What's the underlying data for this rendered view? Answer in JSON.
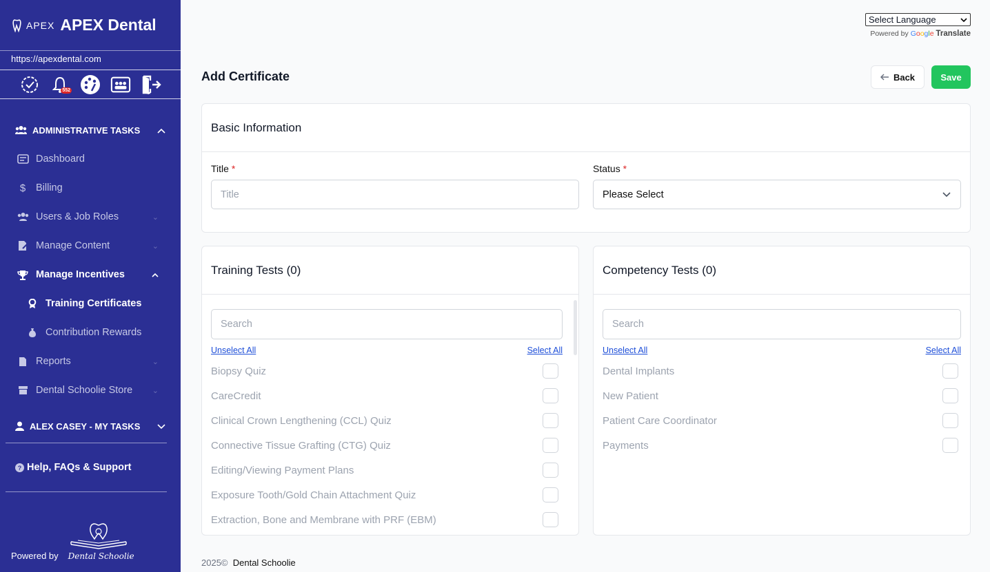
{
  "sidebar": {
    "brand_logo": "APEX",
    "brand_name": "APEX Dental",
    "site_url": "https://apexdental.com",
    "notification_count": "552",
    "admin_section": "ADMINISTRATIVE TASKS",
    "items": [
      {
        "label": "Dashboard"
      },
      {
        "label": "Billing"
      },
      {
        "label": "Users & Job Roles"
      },
      {
        "label": "Manage Content"
      },
      {
        "label": "Manage Incentives"
      },
      {
        "label": "Training Certificates"
      },
      {
        "label": "Contribution Rewards"
      },
      {
        "label": "Reports"
      },
      {
        "label": "Dental Schoolie Store"
      }
    ],
    "my_tasks_section": "ALEX CASEY - MY TASKS",
    "help": "Help, FAQs & Support",
    "powered_by": "Powered by",
    "powered_logo_text": "Dental Schoolie"
  },
  "translate": {
    "select_label": "Select Language",
    "powered_by": "Powered by",
    "translate_word": "Translate"
  },
  "page": {
    "title": "Add Certificate",
    "back": "Back",
    "save": "Save"
  },
  "basic": {
    "heading": "Basic Information",
    "title_label": "Title",
    "title_placeholder": "Title",
    "status_label": "Status",
    "status_value": "Please Select",
    "required_mark": "*"
  },
  "training": {
    "heading": "Training Tests (0)",
    "search_placeholder": "Search",
    "unselect_all": "Unselect All",
    "select_all": "Select All",
    "items": [
      "Biopsy Quiz",
      "CareCredit",
      "Clinical Crown Lengthening (CCL) Quiz",
      "Connective Tissue Grafting (CTG) Quiz",
      "Editing/Viewing Payment Plans",
      "Exposure Tooth/Gold Chain Attachment Quiz",
      "Extraction, Bone and Membrane with PRF (EBM)"
    ]
  },
  "competency": {
    "heading": "Competency Tests (0)",
    "search_placeholder": "Search",
    "unselect_all": "Unselect All",
    "select_all": "Select All",
    "items": [
      "Dental Implants",
      "New Patient",
      "Patient Care Coordinator",
      "Payments"
    ]
  },
  "footer": {
    "year": "2025©",
    "name": "Dental Schoolie"
  }
}
